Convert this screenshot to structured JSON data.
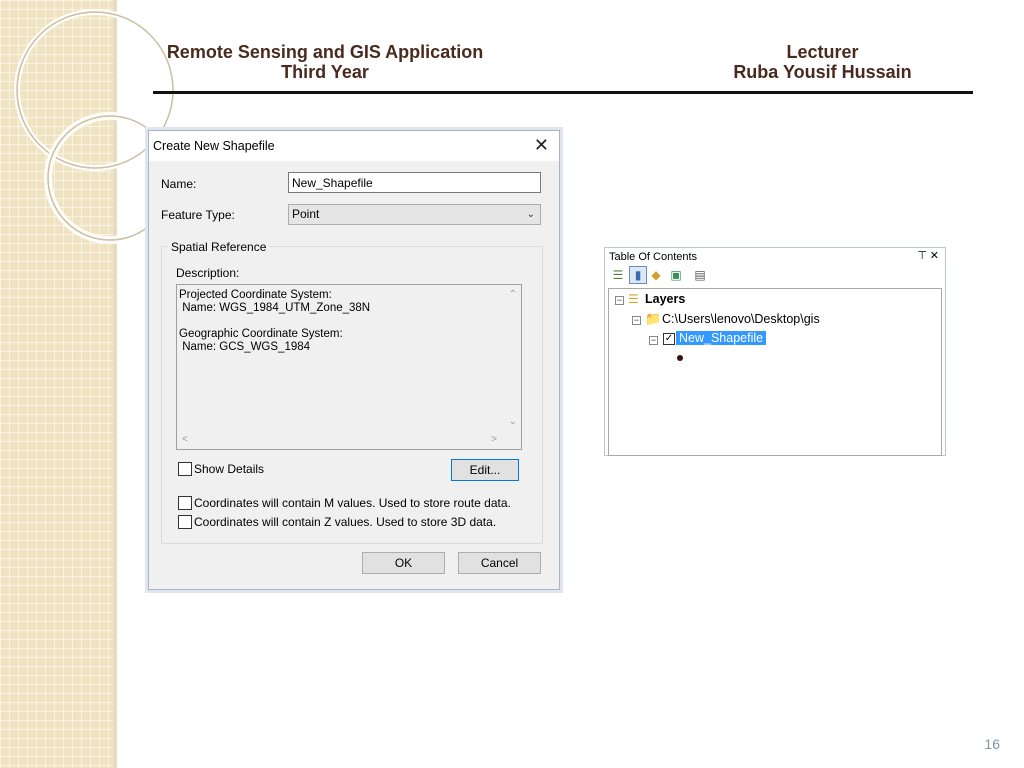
{
  "header": {
    "left_line1": "Remote Sensing and GIS Application",
    "left_line2": "Third Year",
    "right_line1": "Lecturer",
    "right_line2": "Ruba Yousif Hussain"
  },
  "dialog": {
    "title": "Create New Shapefile",
    "close_glyph": "✕",
    "name_label": "Name:",
    "name_value": "New_Shapefile",
    "feature_type_label": "Feature Type:",
    "feature_type_value": "Point",
    "spatial_reference_legend": "Spatial Reference",
    "description_label": "Description:",
    "description_lines": [
      "Projected Coordinate System:",
      " Name: WGS_1984_UTM_Zone_38N",
      "",
      "Geographic Coordinate System:",
      " Name: GCS_WGS_1984"
    ],
    "show_details_label": "Show Details",
    "edit_button": "Edit...",
    "m_values_label": "Coordinates will contain M values. Used to store route data.",
    "z_values_label": "Coordinates will contain Z values. Used to store 3D data.",
    "ok_button": "OK",
    "cancel_button": "Cancel"
  },
  "toc": {
    "title": "Table Of Contents",
    "pin_glyph": "📌",
    "close_glyph": "✕",
    "toolbar_icons": [
      "list-by-drawing-order-icon",
      "list-by-source-icon",
      "list-by-visibility-icon",
      "list-by-selection-icon",
      "options-icon"
    ],
    "tree": {
      "root_label": "Layers",
      "folder_label": "C:\\Users\\lenovo\\Desktop\\gis",
      "layer_label": "New_Shapefile"
    },
    "colors": {
      "selection": "#3399ff",
      "point_symbol": "#3a0f0f"
    }
  },
  "page_number": "16"
}
